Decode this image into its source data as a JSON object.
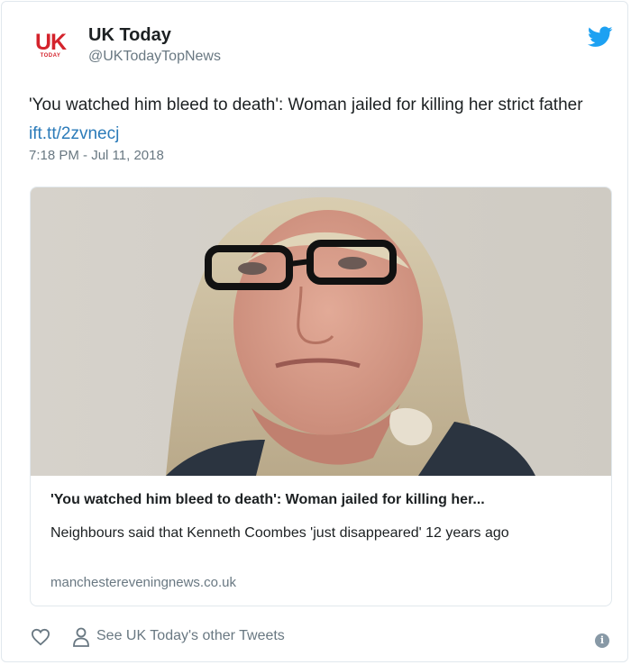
{
  "tweet": {
    "author_name": "UK Today",
    "author_handle": "@UKTodayTopNews",
    "avatar_text": "UK",
    "avatar_subtext": "TODAY",
    "text_before_link": "'You watched him bleed to death': Woman jailed for killing her strict father ",
    "link_text": "ift.tt/2zvnecj",
    "timestamp": "7:18 PM - Jul 11, 2018"
  },
  "card": {
    "title": "'You watched him bleed to death': Woman jailed for killing her...",
    "description": "Neighbours said that Kenneth Coombes 'just disappeared' 12 years ago",
    "domain": "manchestereveningnews.co.uk"
  },
  "footer": {
    "other_tweets_label": "See UK Today's other Tweets",
    "info_icon_text": "i"
  },
  "colors": {
    "brand_red": "#d4232c",
    "twitter_blue": "#1da1f2",
    "link_blue": "#2b7bb9",
    "secondary_text": "#697882"
  },
  "icons": [
    "twitter-bird-icon",
    "heart-icon",
    "person-icon",
    "info-icon"
  ]
}
